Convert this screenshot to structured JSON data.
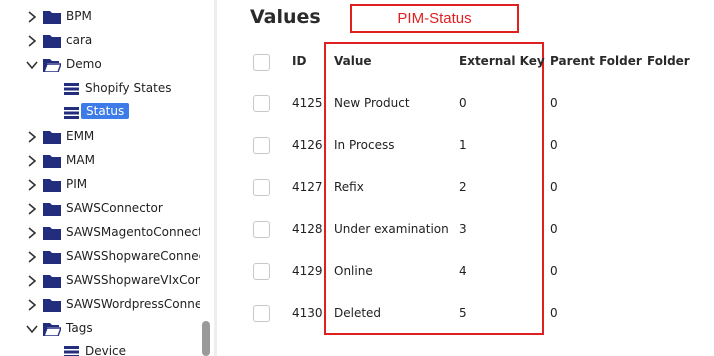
{
  "sidebar": {
    "items": [
      {
        "label": "BPM",
        "expanded": false
      },
      {
        "label": "cara",
        "expanded": false
      },
      {
        "label": "Demo",
        "expanded": true
      },
      {
        "label": "Shopify States",
        "child": true
      },
      {
        "label": "Status",
        "child": true,
        "selected": true
      },
      {
        "label": "EMM",
        "expanded": false
      },
      {
        "label": "MAM",
        "expanded": false
      },
      {
        "label": "PIM",
        "expanded": false
      },
      {
        "label": "SAWSConnector",
        "expanded": false
      },
      {
        "label": "SAWSMagentoConnecto",
        "expanded": false
      },
      {
        "label": "SAWSShopwareConnecto",
        "expanded": false
      },
      {
        "label": "SAWSShopwareVIxConn",
        "expanded": false
      },
      {
        "label": "SAWSWordpressConnec",
        "expanded": false
      },
      {
        "label": "Tags",
        "expanded": true
      },
      {
        "label": "Device",
        "child": true
      }
    ]
  },
  "main": {
    "title": "Values",
    "annotation_label": "PIM-Status",
    "columns": {
      "id": "ID",
      "value": "Value",
      "external_key": "External Key",
      "parent_folder": "Parent Folder",
      "folder": "Folder"
    },
    "rows": [
      {
        "id": "4125",
        "value": "New Product",
        "external_key": "0",
        "parent_folder": "0"
      },
      {
        "id": "4126",
        "value": "In Process",
        "external_key": "1",
        "parent_folder": "0"
      },
      {
        "id": "4127",
        "value": "Refix",
        "external_key": "2",
        "parent_folder": "0"
      },
      {
        "id": "4128",
        "value": "Under examination",
        "external_key": "3",
        "parent_folder": "0"
      },
      {
        "id": "4129",
        "value": "Online",
        "external_key": "4",
        "parent_folder": "0"
      },
      {
        "id": "4130",
        "value": "Deleted",
        "external_key": "5",
        "parent_folder": "0"
      }
    ]
  },
  "colors": {
    "folder": "#232d7e",
    "selected": "#3d7be8",
    "annotation": "#e02020"
  },
  "icons": {
    "collapsed": "chevron-right-icon",
    "expanded": "chevron-down-icon",
    "folder": "folder-icon",
    "open_folder": "folder-open-icon",
    "list": "list-icon"
  }
}
